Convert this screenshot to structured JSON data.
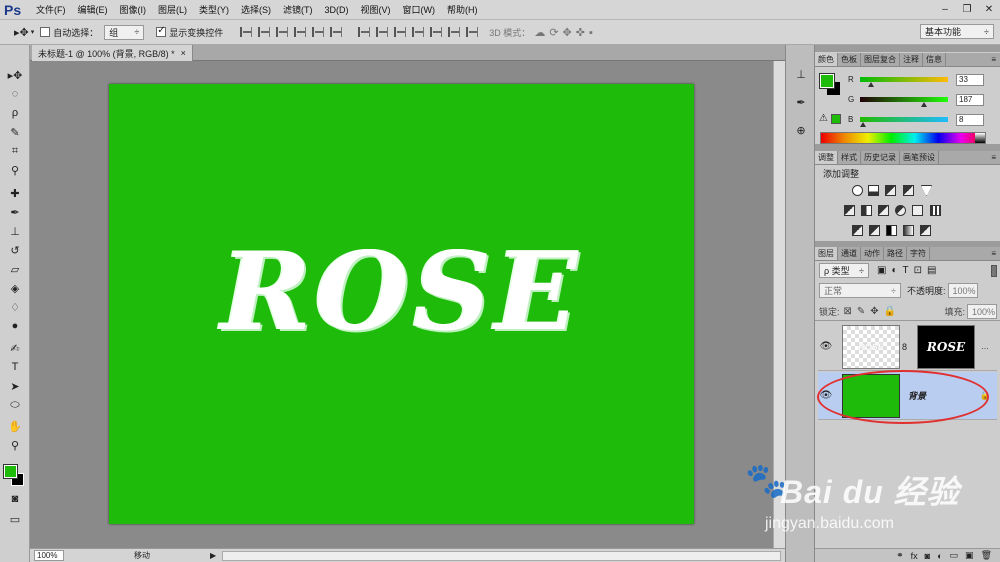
{
  "app": {
    "logo": "Ps"
  },
  "menu": [
    "文件(F)",
    "编辑(E)",
    "图像(I)",
    "图层(L)",
    "类型(Y)",
    "选择(S)",
    "滤镜(T)",
    "3D(D)",
    "视图(V)",
    "窗口(W)",
    "帮助(H)"
  ],
  "window_controls": {
    "minimize": "–",
    "restore": "❐",
    "close": "✕"
  },
  "options": {
    "auto_select_label": "自动选择：",
    "auto_select_target": "组",
    "show_transform_label": "显示变换控件",
    "mode_3d_label": "3D 模式：",
    "workspace": "基本功能"
  },
  "document": {
    "tab_title": "未标题-1 @ 100% (背景, RGB/8) *",
    "close": "×",
    "canvas_text": "ROSE",
    "canvas_color": "#1ebb0a"
  },
  "status": {
    "zoom": "100%",
    "tool": "移动"
  },
  "color_panel": {
    "tabs": [
      "颜色",
      "色板",
      "图层复合",
      "注释",
      "信息"
    ],
    "r_label": "R",
    "g_label": "G",
    "b_label": "B",
    "r": "33",
    "g": "187",
    "b": "8",
    "r_fraction": 0.13,
    "g_fraction": 0.73,
    "b_fraction": 0.03
  },
  "adjust_panel": {
    "tabs": [
      "调整",
      "样式",
      "历史记录",
      "画笔预设"
    ],
    "heading": "添加调整"
  },
  "layers_panel": {
    "tabs": [
      "图层",
      "通道",
      "动作",
      "路径",
      "字符"
    ],
    "filter_kind": "ρ 类型",
    "blend_mode": "正常",
    "opacity_label": "不透明度:",
    "opacity": "100%",
    "lock_label": "锁定:",
    "fill_label": "填充:",
    "fill": "100%",
    "layers": [
      {
        "name": "",
        "thumb_text": "ROSE",
        "mask_text": "ROSE",
        "selected": false
      },
      {
        "name": "背景",
        "selected": true,
        "locked": true
      }
    ]
  },
  "watermark": {
    "logo": "Bai du 经验",
    "url": "jingyan.baidu.com"
  }
}
